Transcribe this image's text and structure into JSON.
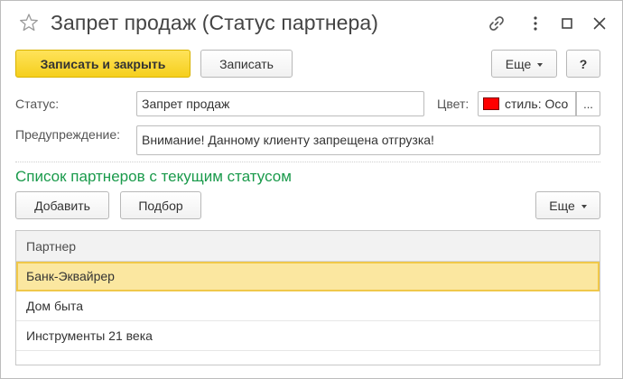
{
  "window": {
    "title": "Запрет продаж (Статус партнера)",
    "icons": [
      "star-icon",
      "link-icon",
      "more-vertical-icon",
      "maximize-icon",
      "close-icon"
    ]
  },
  "toolbar": {
    "save_close_label": "Записать и закрыть",
    "save_label": "Записать",
    "more_label": "Еще",
    "help_label": "?"
  },
  "form": {
    "status_label": "Статус:",
    "status_value": "Запрет продаж",
    "color_label": "Цвет:",
    "color_value": "стиль: Осо",
    "color_swatch": "#ff0000",
    "color_choose_label": "...",
    "warning_label": "Предупреждение:",
    "warning_value": "Внимание! Данному клиенту запрещена отгрузка!"
  },
  "partners": {
    "section_title": "Список партнеров с текущим статусом",
    "add_label": "Добавить",
    "select_label": "Подбор",
    "more_label": "Еще",
    "column_header": "Партнер",
    "rows": [
      {
        "name": "Банк-Эквайрер",
        "selected": true
      },
      {
        "name": "Дом быта",
        "selected": false
      },
      {
        "name": "Инструменты 21 века",
        "selected": false
      }
    ]
  },
  "colors": {
    "accent_green": "#1a9a4b",
    "primary_button": "#f5cf1d",
    "selection": "#fbe7a0"
  }
}
